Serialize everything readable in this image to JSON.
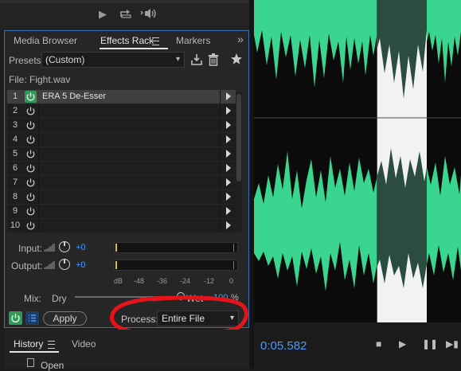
{
  "transport": {
    "play_icon": "play-icon",
    "loop_icon": "loop-icon",
    "skip_icon": "skip-selection-icon"
  },
  "tabs": {
    "media_browser": "Media Browser",
    "effects_rack": "Effects Rack",
    "markers": "Markers",
    "more": "»"
  },
  "presets": {
    "label": "Presets:",
    "value": "(Custom)"
  },
  "file": {
    "label": "File: Fight.wav"
  },
  "rack": {
    "slots": [
      {
        "num": "1",
        "name": "ERA 5 De-Esser",
        "on": true
      },
      {
        "num": "2",
        "name": "",
        "on": false
      },
      {
        "num": "3",
        "name": "",
        "on": false
      },
      {
        "num": "4",
        "name": "",
        "on": false
      },
      {
        "num": "5",
        "name": "",
        "on": false
      },
      {
        "num": "6",
        "name": "",
        "on": false
      },
      {
        "num": "7",
        "name": "",
        "on": false
      },
      {
        "num": "8",
        "name": "",
        "on": false
      },
      {
        "num": "9",
        "name": "",
        "on": false
      },
      {
        "num": "10",
        "name": "",
        "on": false
      }
    ]
  },
  "io": {
    "input_label": "Input:",
    "input_value": "+0",
    "output_label": "Output:",
    "output_value": "+0",
    "scale": [
      "dB",
      "-48",
      "-36",
      "-24",
      "-12",
      "0"
    ]
  },
  "mix": {
    "label": "Mix:",
    "dry": "Dry",
    "wet": "Wet",
    "value": "100",
    "unit": "%",
    "level": 1.0
  },
  "controls": {
    "apply": "Apply",
    "process_label": "Process:",
    "process_value": "Entire File"
  },
  "history": {
    "history_tab": "History",
    "video_tab": "Video",
    "item": "Open"
  },
  "editor": {
    "timecode": "0:05.582"
  },
  "colors": {
    "accent": "#4a9bff",
    "waveform": "#3ad68f",
    "power_on": "#2e9a55",
    "annotation": "#e5141b"
  }
}
